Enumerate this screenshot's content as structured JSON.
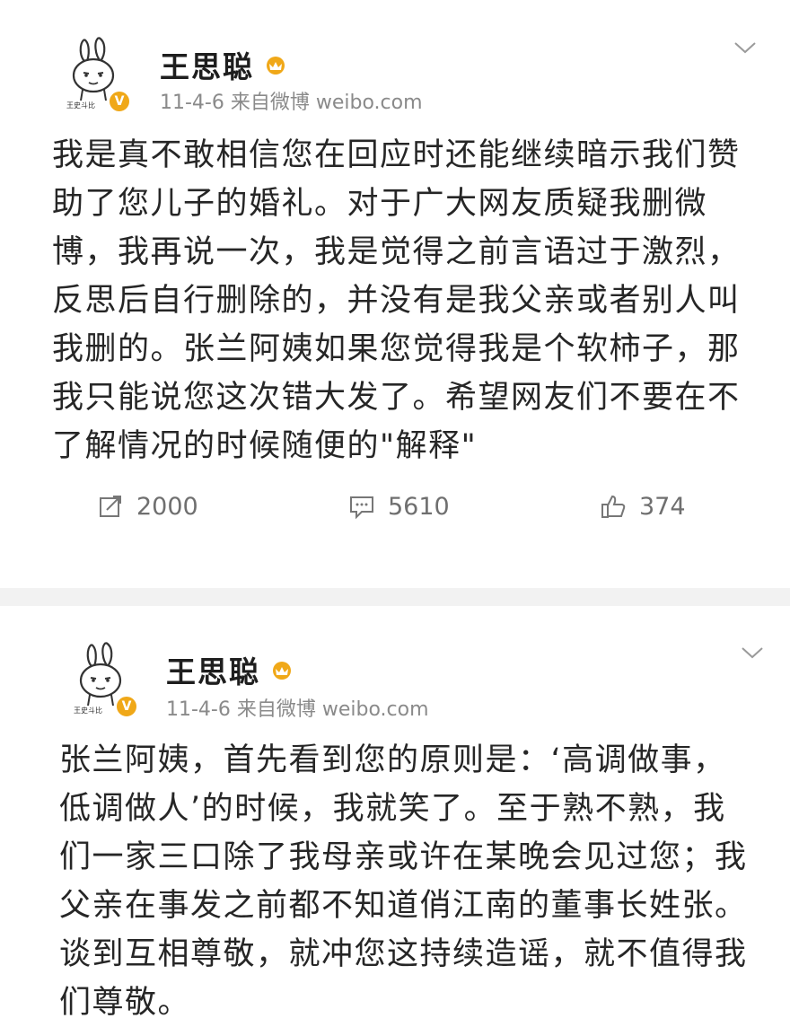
{
  "posts": [
    {
      "username": "王思聪",
      "meta": "11-4-6  来自微博 weibo.com",
      "body": "我是真不敢相信您在回应时还能继续暗示我们赞助了您儿子的婚礼。对于广大网友质疑我删微博，我再说一次，我是觉得之前言语过于激烈，反思后自行删除的，并没有是我父亲或者别人叫我删的。张兰阿姨如果您觉得我是个软柿子，那我只能说您这次错大发了。希望网友们不要在不了解情况的时候随便的\"解释\"",
      "reposts": "2000",
      "comments": "5610",
      "likes": "374"
    },
    {
      "username": "王思聪",
      "meta": "11-4-6  来自微博 weibo.com",
      "body": "张兰阿姨，首先看到您的原则是：‘高调做事，低调做人’的时候，我就笑了。至于熟不熟，我们一家三口除了我母亲或许在某晚会见过您；我父亲在事发之前都不知道俏江南的董事长姓张。谈到互相尊敬，就冲您这持续造谣，就不值得我们尊敬。"
    }
  ],
  "icons": {
    "avatar": "cartoon-rabbit-avatar-icon",
    "verified": "verified-v-badge-icon",
    "member": "weibo-member-crown-icon",
    "chevron": "chevron-down-icon",
    "repost": "repost-icon",
    "comment": "comment-icon",
    "like": "thumbs-up-icon"
  },
  "colors": {
    "verified": "#f0a818",
    "member": "#f0a818",
    "text": "#262626",
    "meta": "#8a8a8a",
    "separator": "#f2f2f2"
  }
}
